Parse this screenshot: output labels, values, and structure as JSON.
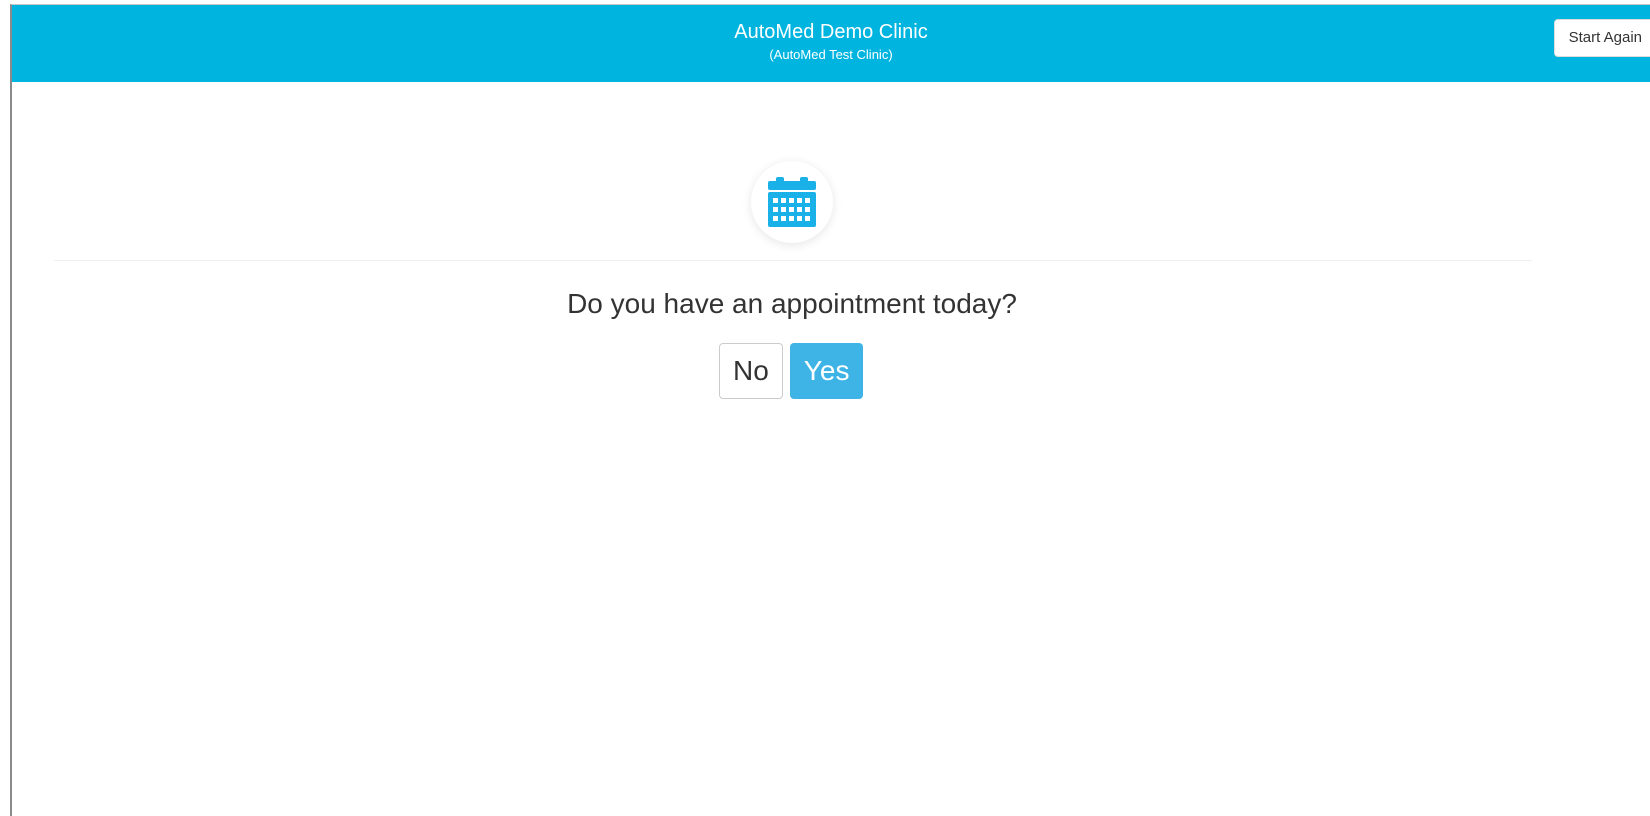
{
  "header": {
    "title": "AutoMed Demo Clinic",
    "subtitle": "(AutoMed Test Clinic)",
    "start_again_label": "Start Again"
  },
  "main": {
    "icon": "calendar-icon",
    "question": "Do you have an appointment today?",
    "no_label": "No",
    "yes_label": "Yes"
  },
  "colors": {
    "header_bg": "#00b4e0",
    "accent": "#3db4e5",
    "icon": "#1ab0e8"
  }
}
